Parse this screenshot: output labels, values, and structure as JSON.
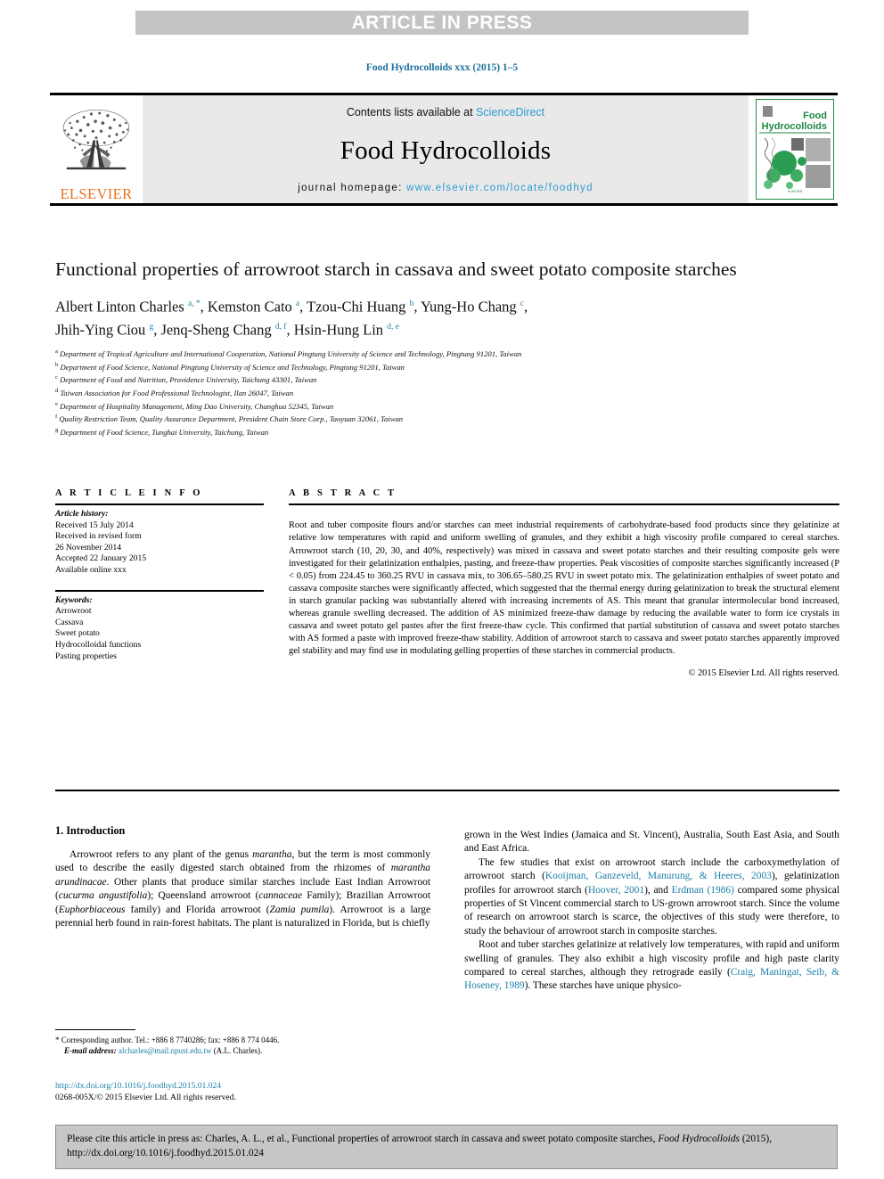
{
  "banner": {
    "text": "ARTICLE IN PRESS"
  },
  "running_head": {
    "text": "Food Hydrocolloids xxx (2015) 1–5"
  },
  "masthead": {
    "contents_prefix": "Contents lists available at ",
    "sciencedirect": "ScienceDirect",
    "journal_title": "Food Hydrocolloids",
    "homepage_label": "journal homepage: ",
    "homepage_url": "www.elsevier.com/locate/foodhyd",
    "publisher": "ELSEVIER",
    "cover_title_line1": "Food",
    "cover_title_line2": "Hydrocolloids",
    "accent_blue": "#2e9ad0",
    "elsevier_orange": "#e8711a",
    "cover_green": "#1f8a43"
  },
  "article": {
    "title": "Functional properties of arrowroot starch in cassava and sweet potato composite starches",
    "authors_line1": [
      {
        "name": "Albert Linton Charles",
        "sup": "a, *"
      },
      {
        "name": "Kemston Cato",
        "sup": "a"
      },
      {
        "name": "Tzou-Chi Huang",
        "sup": "b"
      },
      {
        "name": "Yung-Ho Chang",
        "sup": "c"
      }
    ],
    "authors_line2": [
      {
        "name": "Jhih-Ying Ciou",
        "sup": "g"
      },
      {
        "name": "Jenq-Sheng Chang",
        "sup": "d, f"
      },
      {
        "name": "Hsin-Hung Lin",
        "sup": "d, e"
      }
    ],
    "affiliations": [
      {
        "mark": "a",
        "text": "Department of Tropical Agriculture and International Cooperation, National Pingtung University of Science and Technology, Pingtung 91201, Taiwan"
      },
      {
        "mark": "b",
        "text": "Department of Food Science, National Pingtung University of Science and Technology, Pingtung 91201, Taiwan"
      },
      {
        "mark": "c",
        "text": "Department of Food and Nutrition, Providence University, Taichung 43301, Taiwan"
      },
      {
        "mark": "d",
        "text": "Taiwan Association for Food Professional Technologist, Ilan 26047, Taiwan"
      },
      {
        "mark": "e",
        "text": "Department of Hospitality Management, Ming Dao University, Changhua 52345, Taiwan"
      },
      {
        "mark": "f",
        "text": "Quality Restriction Team, Quality Assurance Department, President Chain Store Corp., Taoyuan 32061, Taiwan"
      },
      {
        "mark": "g",
        "text": "Department of Food Science, Tunghai University, Taichung, Taiwan"
      }
    ]
  },
  "article_info": {
    "heading": "A R T I C L E  I N F O",
    "history_label": "Article history:",
    "history": [
      "Received 15 July 2014",
      "Received in revised form",
      "26 November 2014",
      "Accepted 22 January 2015",
      "Available online xxx"
    ],
    "keywords_label": "Keywords:",
    "keywords": [
      "Arrowroot",
      "Cassava",
      "Sweet potato",
      "Hydrocolloidal functions",
      "Pasting properties"
    ]
  },
  "abstract": {
    "heading": "A B S T R A C T",
    "text": "Root and tuber composite flours and/or starches can meet industrial requirements of carbohydrate-based food products since they gelatinize at relative low temperatures with rapid and uniform swelling of granules, and they exhibit a high viscosity profile compared to cereal starches. Arrowroot starch (10, 20, 30, and 40%, respectively) was mixed in cassava and sweet potato starches and their resulting composite gels were investigated for their gelatinization enthalpies, pasting, and freeze-thaw properties. Peak viscosities of composite starches significantly increased (P < 0.05) from 224.45 to 360.25 RVU in cassava mix, to 306.65–580.25 RVU in sweet potato mix. The gelatinization enthalpies of sweet potato and cassava composite starches were significantly affected, which suggested that the thermal energy during gelatinization to break the structural element in starch granular packing was substantially altered with increasing increments of AS. This meant that granular intermolecular bond increased, whereas granule swelling decreased. The addition of AS minimized freeze-thaw damage by reducing the available water to form ice crystals in cassava and sweet potato gel pastes after the first freeze-thaw cycle. This confirmed that partial substitution of cassava and sweet potato starches with AS formed a paste with improved freeze-thaw stability. Addition of arrowroot starch to cassava and sweet potato starches apparently improved gel stability and may find use in modulating gelling properties of these starches in commercial products.",
    "copyright": "© 2015 Elsevier Ltd. All rights reserved."
  },
  "introduction": {
    "heading": "1. Introduction",
    "left_paragraph_1_html": "Arrowroot refers to any plant of the genus <i>marantha</i>, but the term is most commonly used to describe the easily digested starch obtained from the rhizomes of <i>marantha arundinacae</i>. Other plants that produce similar starches include East Indian Arrowroot (<i>cucurma angustifolia</i>); Queensland arrowroot (<i>cannaceae</i> Family); Brazilian Arrowroot (<i>Euphorbiaceous</i> family) and Florida arrowroot (<i>Zamia pumila</i>). Arrowroot is a large perennial herb found in rain-forest habitats. The plant is naturalized in Florida, but is chiefly",
    "right_paragraph_1_html": "grown in the West Indies (Jamaica and St. Vincent), Australia, South East Asia, and South and East Africa.",
    "right_paragraph_2_html": "The few studies that exist on arrowroot starch include the carboxymethylation of arrowroot starch (<span class=\"ref\">Kooijman, Ganzeveld, Manurung, &amp; Heeres, 2003</span>), gelatinization profiles for arrowroot starch (<span class=\"ref\">Hoover, 2001</span>), and <span class=\"ref\">Erdman (1986)</span> compared some physical properties of St Vincent commercial starch to US-grown arrowroot starch. Since the volume of research on arrowroot starch is scarce, the objectives of this study were therefore, to study the behaviour of arrowroot starch in composite starches.",
    "right_paragraph_3_html": "Root and tuber starches gelatinize at relatively low temperatures, with rapid and uniform swelling of granules. They also exhibit a high viscosity profile and high paste clarity compared to cereal starches, although they retrograde easily (<span class=\"ref\">Craig, Maningat, Seib, &amp; Hoseney, 1989</span>). These starches have unique physico-"
  },
  "footnote": {
    "corresponding": "Corresponding author. Tel.: +886 8 7740286; fax: +886 8 774 0446.",
    "email_label": "E-mail address:",
    "email": "alcharles@mail.npust.edu.tw",
    "email_owner": "(A.L. Charles)."
  },
  "doi_block": {
    "doi_url": "http://dx.doi.org/10.1016/j.foodhyd.2015.01.024",
    "issn_line": "0268-005X/© 2015 Elsevier Ltd. All rights reserved."
  },
  "cite_box": {
    "line1": "Please cite this article in press as: Charles, A. L., et al., Functional properties of arrowroot starch in cassava and sweet potato composite starches,",
    "journal": "Food Hydrocolloids",
    "line2_rest": " (2015), http://dx.doi.org/10.1016/j.foodhyd.2015.01.024"
  }
}
